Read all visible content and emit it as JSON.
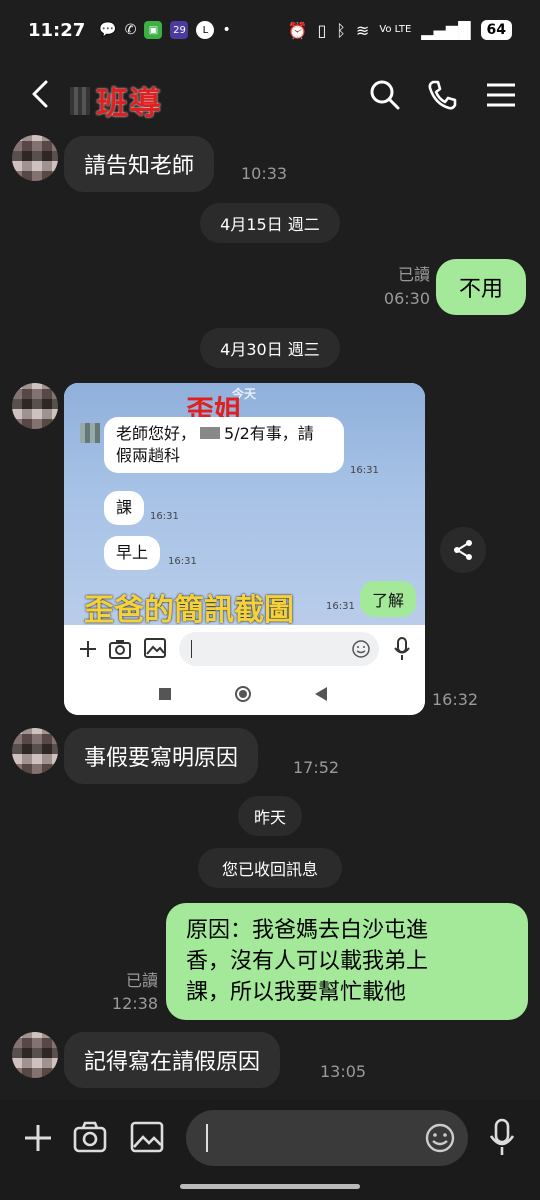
{
  "status_bar": {
    "time": "11:27",
    "battery": "64",
    "signal": "Vo LTE"
  },
  "header": {
    "title": "班導"
  },
  "messages": {
    "m1": {
      "text": "請告知老師",
      "time": "10:33"
    },
    "date1": "4月15日 週二",
    "m2": {
      "text": "不用",
      "read": "已讀",
      "time": "06:30"
    },
    "date2": "4月30日 週三",
    "image": {
      "time": "16:32",
      "overlay_top_label": "歪姐",
      "overlay_caption": "歪爸的簡訊截圖",
      "today_label": "今天",
      "bubble1": "老師您好，",
      "bubble1b": "5/2有事，請",
      "bubble1c": "假兩趟科",
      "bubble1_time": "16:31",
      "bubble2": "課",
      "bubble2_time": "16:31",
      "bubble3": "早上",
      "bubble3_time": "16:31",
      "green": "了解",
      "green_time": "16:31"
    },
    "m3": {
      "text": "事假要寫明原因",
      "time": "17:52"
    },
    "date3": "昨天",
    "recall": "您已收回訊息",
    "m4": {
      "line1": "原因：我爸媽去白沙屯進",
      "line2": "香，沒有人可以載我弟上",
      "line3": "課，所以我要幫忙載他",
      "read": "已讀",
      "time": "12:38"
    },
    "m5": {
      "text": "記得寫在請假原因",
      "time": "13:05"
    }
  },
  "icons": [
    "back-arrow-icon",
    "search-icon",
    "phone-icon",
    "menu-icon",
    "share-icon",
    "plus-icon",
    "camera-icon",
    "image-icon",
    "emoji-icon",
    "mic-icon"
  ]
}
